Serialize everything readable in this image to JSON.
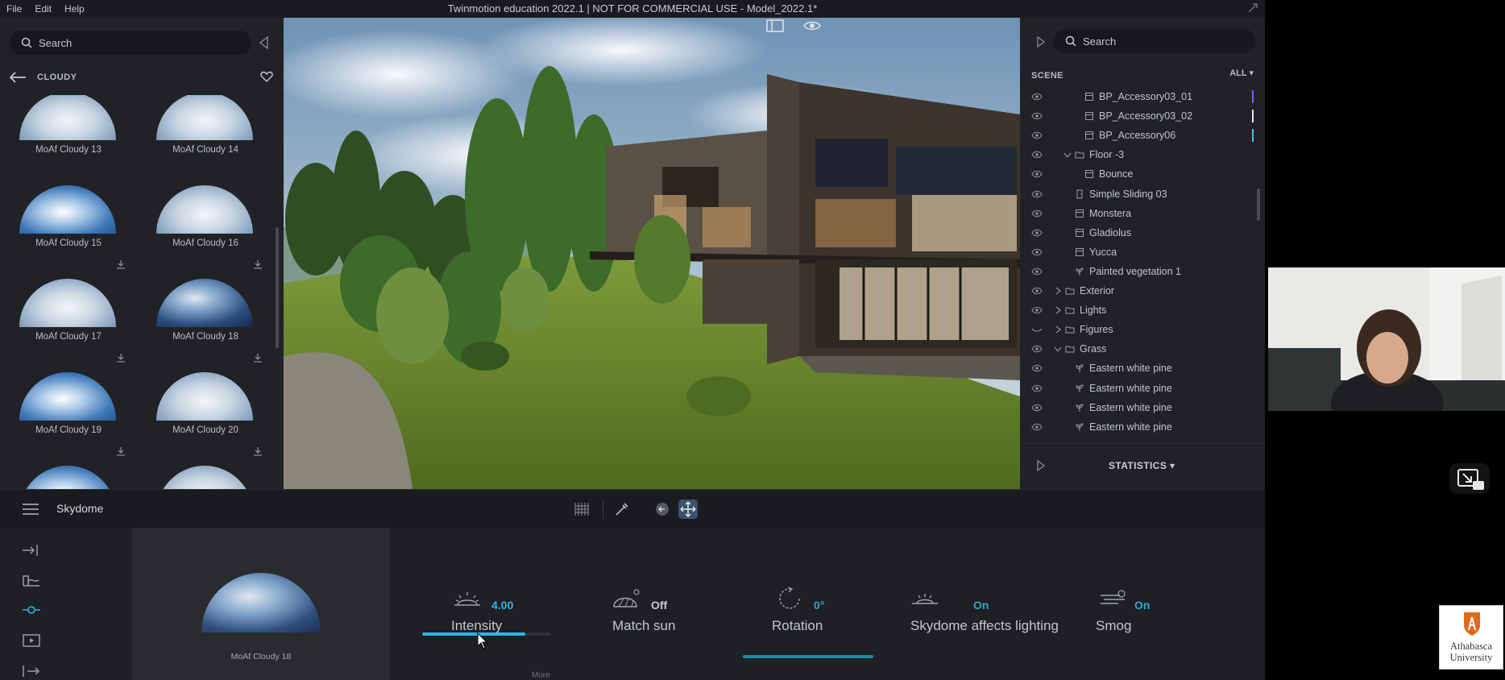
{
  "titlebar": {
    "menu": [
      "File",
      "Edit",
      "Help"
    ],
    "title": "Twinmotion education 2022.1 | NOT FOR COMMERCIAL USE - Model_2022.1*"
  },
  "library": {
    "search_placeholder": "Search",
    "category": "CLOUDY",
    "items": [
      {
        "label": "MoAf Cloudy 13",
        "tone": "light"
      },
      {
        "label": "MoAf Cloudy 14",
        "tone": "light"
      },
      {
        "label": "MoAf Cloudy 15",
        "tone": "blue"
      },
      {
        "label": "MoAf Cloudy 16",
        "tone": "light"
      },
      {
        "label": "MoAf Cloudy 17",
        "tone": "light"
      },
      {
        "label": "MoAf Cloudy 18",
        "tone": "dark"
      },
      {
        "label": "MoAf Cloudy 19",
        "tone": "blue"
      },
      {
        "label": "MoAf Cloudy 20",
        "tone": "light"
      },
      {
        "label": "",
        "tone": "blue"
      },
      {
        "label": "",
        "tone": "light"
      }
    ]
  },
  "scene": {
    "search_placeholder": "Search",
    "header": "SCENE",
    "filter": "ALL",
    "items": [
      {
        "name": "BP_Accessory03_01",
        "indent": 3,
        "icon": "object",
        "chevron": "",
        "mark": "#7b5cff",
        "visible": true
      },
      {
        "name": "BP_Accessory03_02",
        "indent": 3,
        "icon": "object",
        "chevron": "",
        "mark": "#e8e8e8",
        "visible": true
      },
      {
        "name": "BP_Accessory06",
        "indent": 3,
        "icon": "object",
        "chevron": "",
        "mark": "#3fc2d6",
        "visible": true
      },
      {
        "name": "Floor -3",
        "indent": 2,
        "icon": "folder",
        "chevron": "open",
        "mark": "",
        "visible": true
      },
      {
        "name": "Bounce",
        "indent": 3,
        "icon": "object",
        "chevron": "",
        "mark": "",
        "visible": true
      },
      {
        "name": "Simple Sliding 03",
        "indent": 2,
        "icon": "door",
        "chevron": "",
        "mark": "",
        "visible": true
      },
      {
        "name": "Monstera",
        "indent": 2,
        "icon": "object",
        "chevron": "",
        "mark": "",
        "visible": true
      },
      {
        "name": "Gladiolus",
        "indent": 2,
        "icon": "object",
        "chevron": "",
        "mark": "",
        "visible": true
      },
      {
        "name": "Yucca",
        "indent": 2,
        "icon": "object",
        "chevron": "",
        "mark": "",
        "visible": true
      },
      {
        "name": "Painted vegetation 1",
        "indent": 2,
        "icon": "plant",
        "chevron": "",
        "mark": "",
        "visible": true
      },
      {
        "name": "Exterior",
        "indent": 1,
        "icon": "folder",
        "chevron": "closed",
        "mark": "",
        "visible": true
      },
      {
        "name": "Lights",
        "indent": 1,
        "icon": "folder",
        "chevron": "closed",
        "mark": "",
        "visible": true
      },
      {
        "name": "Figures",
        "indent": 1,
        "icon": "folder",
        "chevron": "closed",
        "mark": "",
        "visible": false
      },
      {
        "name": "Grass",
        "indent": 1,
        "icon": "folder",
        "chevron": "open",
        "mark": "",
        "visible": true
      },
      {
        "name": "Eastern white pine",
        "indent": 2,
        "icon": "plant",
        "chevron": "",
        "mark": "",
        "visible": true
      },
      {
        "name": "Eastern white pine",
        "indent": 2,
        "icon": "plant",
        "chevron": "",
        "mark": "",
        "visible": true
      },
      {
        "name": "Eastern white pine",
        "indent": 2,
        "icon": "plant",
        "chevron": "",
        "mark": "",
        "visible": true
      },
      {
        "name": "Eastern white pine",
        "indent": 2,
        "icon": "plant",
        "chevron": "",
        "mark": "",
        "visible": true
      }
    ],
    "statistics": "STATISTICS"
  },
  "toolbar": {
    "panel_name": "Skydome"
  },
  "properties": {
    "preview_label": "MoAf Cloudy 18",
    "intensity": {
      "label": "Intensity",
      "value": "4.00",
      "level": 0.8
    },
    "match_sun": {
      "label": "Match sun",
      "value": "Off"
    },
    "rotation": {
      "label": "Rotation",
      "value": "0°"
    },
    "skydome_lighting": {
      "label": "Skydome affects lighting",
      "value": "On"
    },
    "smog": {
      "label": "Smog",
      "value": "On"
    },
    "more": "More"
  },
  "logo": {
    "line1": "Athabasca",
    "line2": "University"
  },
  "colors": {
    "accent": "#2cb6e8",
    "value_cyan": "#2aa9cf",
    "panel": "#212226",
    "logo_orange": "#e06a1b"
  }
}
